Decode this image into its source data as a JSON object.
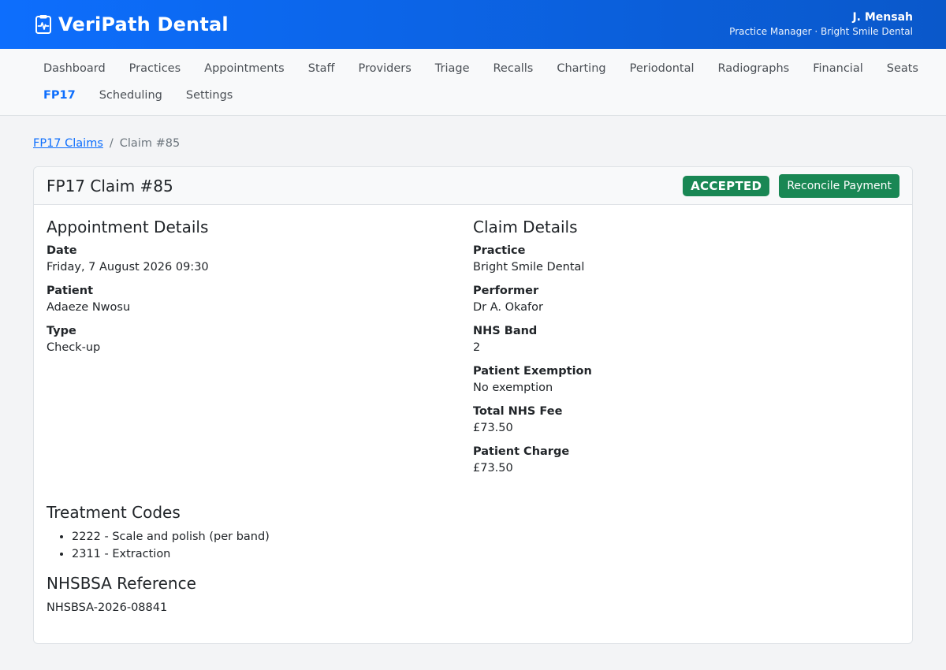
{
  "app": {
    "brand": "VeriPath Dental",
    "icon": "clipboard-pulse-icon",
    "user_name": "J. Mensah",
    "user_role": "Practice Manager · Bright Smile Dental"
  },
  "nav": {
    "row1": [
      "Dashboard",
      "Practices",
      "Appointments",
      "Staff",
      "Providers",
      "Triage",
      "Recalls",
      "Charting",
      "Periodontal",
      "Radiographs",
      "Financial",
      "Seats"
    ],
    "row2": [
      "FP17",
      "Scheduling",
      "Settings"
    ],
    "active": "FP17"
  },
  "breadcrumb": {
    "parent": "FP17 Claims",
    "separator": "/",
    "current": "Claim #85"
  },
  "claim": {
    "title": "FP17 Claim #85",
    "status": "ACCEPTED",
    "reconcile_label": "Reconcile Payment"
  },
  "appointment": {
    "heading": "Appointment Details",
    "date_label": "Date",
    "date": "Friday, 7 August 2026 09:30",
    "patient_label": "Patient",
    "patient": "Adaeze Nwosu",
    "type_label": "Type",
    "type": "Check-up"
  },
  "details": {
    "heading": "Claim Details",
    "practice_label": "Practice",
    "practice": "Bright Smile Dental",
    "performer_label": "Performer",
    "performer": "Dr A. Okafor",
    "band_label": "NHS Band",
    "band": "2",
    "exemption_label": "Patient Exemption",
    "exemption": "No exemption",
    "fee_label": "Total NHS Fee",
    "fee": "£73.50",
    "charge_label": "Patient Charge",
    "charge": "£73.50"
  },
  "treatment": {
    "heading": "Treatment Codes",
    "codes": [
      "2222 - Scale and polish (per band)",
      "2311 - Extraction"
    ]
  },
  "reference": {
    "heading": "NHSBSA Reference",
    "value": "NHSBSA-2026-08841"
  },
  "colors": {
    "primary": "#0d6efd",
    "success": "#198754"
  }
}
